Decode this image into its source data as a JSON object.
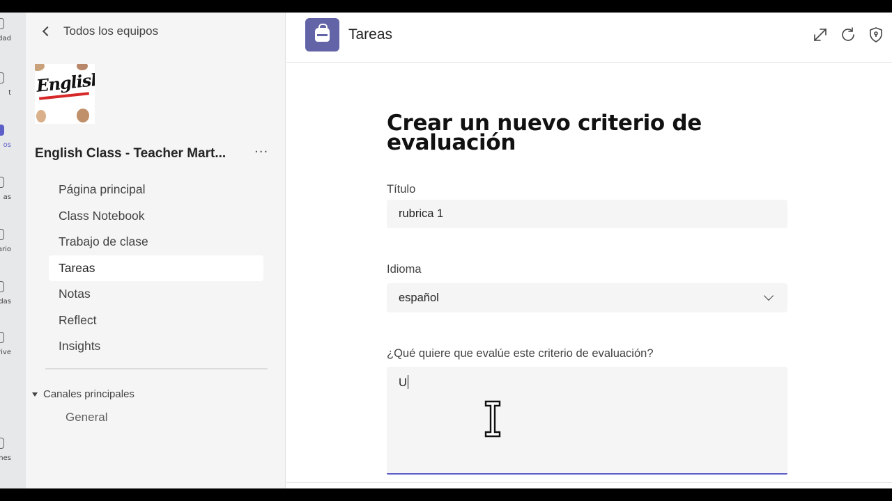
{
  "rail": {
    "items": [
      {
        "label": "dad",
        "active": false
      },
      {
        "label": "t",
        "active": false
      },
      {
        "label": "os",
        "active": true
      },
      {
        "label": "as",
        "active": false
      },
      {
        "label": "ario",
        "active": false
      },
      {
        "label": "das",
        "active": false
      },
      {
        "label": "rive",
        "active": false
      },
      {
        "label": "",
        "active": false
      },
      {
        "label": "ones",
        "active": false
      }
    ]
  },
  "sidebar": {
    "back_label": "Todos los equipos",
    "team_image_text": "English",
    "team_name": "English Class - Teacher Mart...",
    "more_label": "···",
    "nav": [
      {
        "label": "Página principal",
        "active": false
      },
      {
        "label": "Class Notebook",
        "active": false
      },
      {
        "label": "Trabajo de clase",
        "active": false
      },
      {
        "label": "Tareas",
        "active": true
      },
      {
        "label": "Notas",
        "active": false
      },
      {
        "label": "Reflect",
        "active": false
      },
      {
        "label": "Insights",
        "active": false
      }
    ],
    "channels_heading": "Canales principales",
    "channels": [
      "General"
    ]
  },
  "header": {
    "app_title": "Tareas",
    "icons": [
      "expand-icon",
      "refresh-icon",
      "shield-icon"
    ],
    "accent": "#6264a7"
  },
  "form": {
    "title": "Crear un nuevo criterio de evaluación",
    "title_field": {
      "label": "Título",
      "value": "rubrica 1"
    },
    "language_field": {
      "label": "Idioma",
      "value": "español"
    },
    "description_field": {
      "label": "¿Qué quiere que evalúe este criterio de evaluación?",
      "value": "U"
    },
    "focus_color": "#5b5fc7"
  }
}
